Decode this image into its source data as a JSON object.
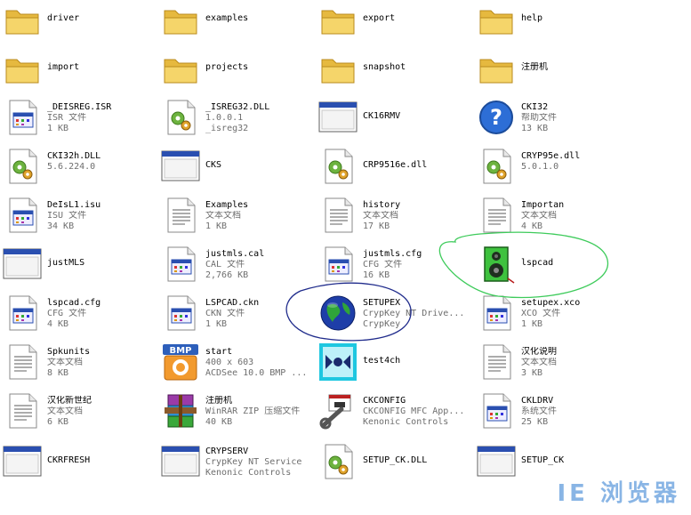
{
  "colors": {
    "folder": "#f5d56a",
    "window_title": "#2a4fb0",
    "green_annotation": "#3ecb5b",
    "blue_annotation": "#202c8c",
    "watermark": "#2a7ad0"
  },
  "watermark_text": "IE 浏览器",
  "files": [
    {
      "icon": "folder-icon",
      "name": "driver",
      "lines": []
    },
    {
      "icon": "folder-icon",
      "name": "examples",
      "lines": []
    },
    {
      "icon": "folder-icon",
      "name": "export",
      "lines": []
    },
    {
      "icon": "folder-icon",
      "name": "help",
      "lines": []
    },
    {
      "icon": "folder-icon",
      "name": "import",
      "lines": []
    },
    {
      "icon": "folder-icon",
      "name": "projects",
      "lines": []
    },
    {
      "icon": "folder-icon",
      "name": "snapshot",
      "lines": []
    },
    {
      "icon": "folder-icon",
      "name": "注册机",
      "lines": []
    },
    {
      "icon": "file-generic-icon",
      "name": "_DEISREG.ISR",
      "lines": [
        "ISR 文件",
        "1 KB"
      ]
    },
    {
      "icon": "dll-gear-icon",
      "name": "_ISREG32.DLL",
      "lines": [
        "1.0.0.1",
        "_isreg32"
      ]
    },
    {
      "icon": "app-window-icon",
      "name": "CK16RMV",
      "lines": []
    },
    {
      "icon": "help-icon",
      "name": "CKI32",
      "lines": [
        "帮助文件",
        "13 KB"
      ]
    },
    {
      "icon": "dll-gear-icon",
      "name": "CKI32h.DLL",
      "lines": [
        "5.6.224.0"
      ]
    },
    {
      "icon": "app-window-icon",
      "name": "CKS",
      "lines": []
    },
    {
      "icon": "dll-gear-icon",
      "name": "CRP9516e.dll",
      "lines": []
    },
    {
      "icon": "dll-gear-icon",
      "name": "CRYP95e.dll",
      "lines": [
        "5.0.1.0"
      ]
    },
    {
      "icon": "file-generic-icon",
      "name": "DeIsL1.isu",
      "lines": [
        "ISU 文件",
        "34 KB"
      ]
    },
    {
      "icon": "text-document-icon",
      "name": "Examples",
      "lines": [
        "文本文档",
        "1 KB"
      ]
    },
    {
      "icon": "text-document-icon",
      "name": "history",
      "lines": [
        "文本文档",
        "17 KB"
      ]
    },
    {
      "icon": "text-document-icon",
      "name": "Importan",
      "lines": [
        "文本文档",
        "4 KB"
      ]
    },
    {
      "icon": "app-window-icon",
      "name": "justMLS",
      "lines": []
    },
    {
      "icon": "file-generic-icon",
      "name": "justmls.cal",
      "lines": [
        "CAL 文件",
        "2,766 KB"
      ]
    },
    {
      "icon": "file-generic-icon",
      "name": "justmls.cfg",
      "lines": [
        "CFG 文件",
        "16 KB"
      ]
    },
    {
      "icon": "speaker-icon",
      "name": "lspcad",
      "lines": []
    },
    {
      "icon": "file-generic-icon",
      "name": "lspcad.cfg",
      "lines": [
        "CFG 文件",
        "4 KB"
      ]
    },
    {
      "icon": "file-generic-icon",
      "name": "LSPCAD.ckn",
      "lines": [
        "CKN 文件",
        "1 KB"
      ]
    },
    {
      "icon": "globe-icon",
      "name": "SETUPEX",
      "lines": [
        "CrypKey NT Drive...",
        "CrypKey"
      ]
    },
    {
      "icon": "file-generic-icon",
      "name": "setupex.xco",
      "lines": [
        "XCO 文件",
        "1 KB"
      ]
    },
    {
      "icon": "text-document-icon",
      "name": "Spkunits",
      "lines": [
        "文本文档",
        "8 KB"
      ]
    },
    {
      "icon": "bmp-image-icon",
      "name": "start",
      "lines": [
        "400 x 603",
        "ACDSee 10.0 BMP ..."
      ]
    },
    {
      "icon": "test-app-icon",
      "name": "test4ch",
      "lines": []
    },
    {
      "icon": "text-document-icon",
      "name": "汉化说明",
      "lines": [
        "文本文档",
        "3 KB"
      ]
    },
    {
      "icon": "text-document-icon",
      "name": "汉化新世纪",
      "lines": [
        "文本文档",
        "6 KB"
      ]
    },
    {
      "icon": "rar-archive-icon",
      "name": "注册机",
      "lines": [
        "WinRAR ZIP 压缩文件",
        "40 KB"
      ]
    },
    {
      "icon": "tools-icon",
      "name": "CKCONFIG",
      "lines": [
        "CKCONFIG MFC App...",
        "Kenonic Controls"
      ]
    },
    {
      "icon": "file-generic-icon",
      "name": "CKLDRV",
      "lines": [
        "系统文件",
        "25 KB"
      ]
    },
    {
      "icon": "app-window-icon",
      "name": "CKRFRESH",
      "lines": []
    },
    {
      "icon": "app-window-icon",
      "name": "CRYPSERV",
      "lines": [
        "CrypKey NT Service",
        "Kenonic Controls"
      ]
    },
    {
      "icon": "dll-gear-icon",
      "name": "SETUP_CK.DLL",
      "lines": []
    },
    {
      "icon": "app-window-icon",
      "name": "SETUP_CK",
      "lines": []
    }
  ]
}
